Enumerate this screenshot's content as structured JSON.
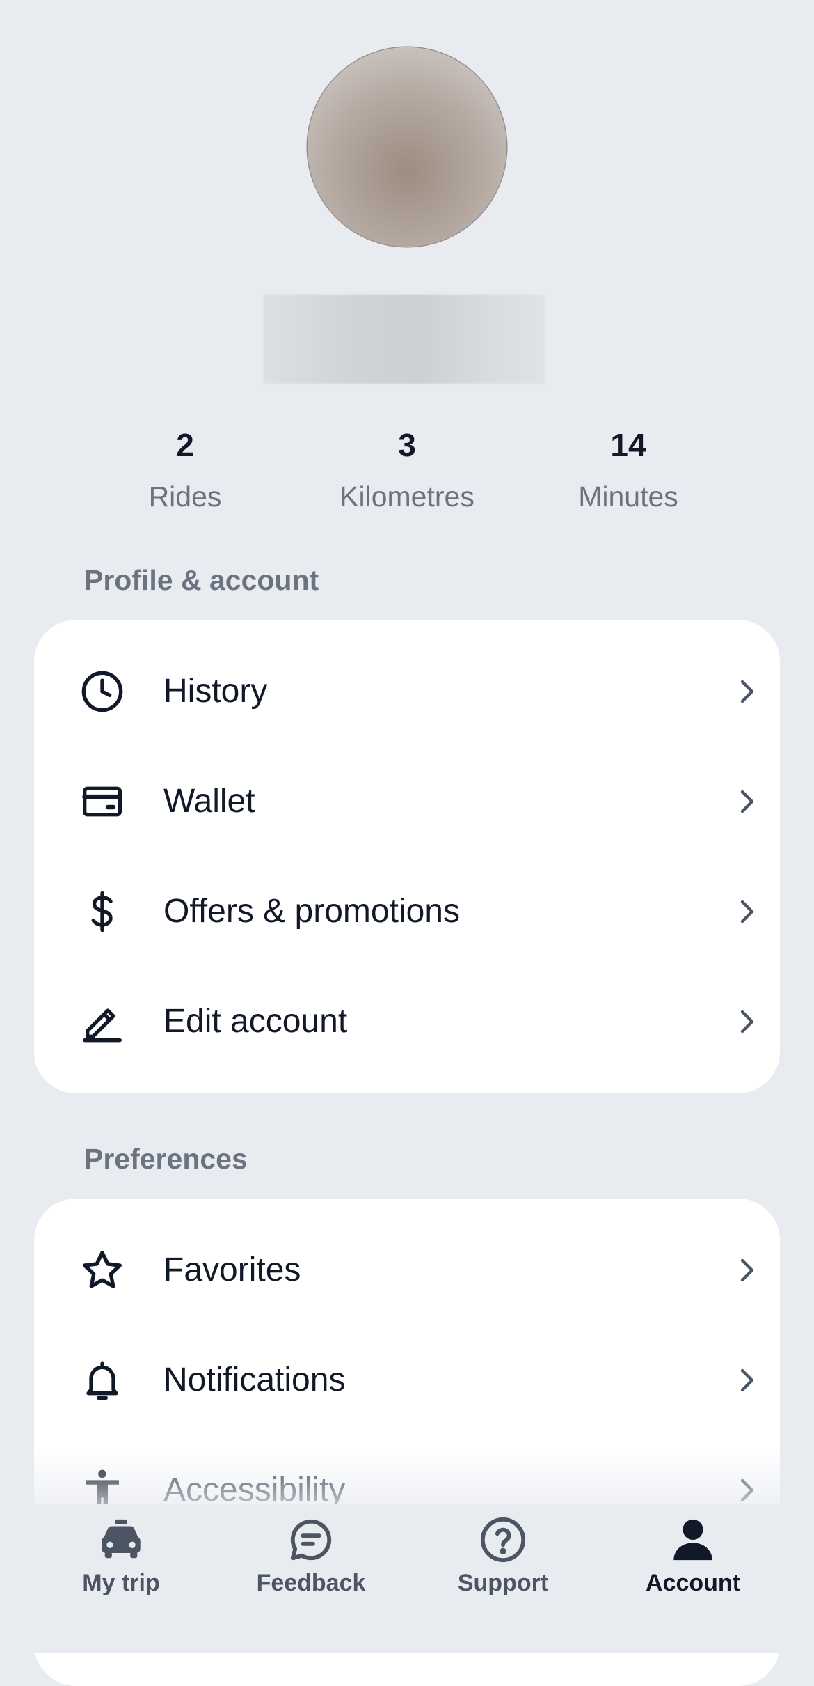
{
  "stats": [
    {
      "value": "2",
      "label": "Rides"
    },
    {
      "value": "3",
      "label": "Kilometres"
    },
    {
      "value": "14",
      "label": "Minutes"
    }
  ],
  "sections": {
    "profile": {
      "title": "Profile & account",
      "items": [
        {
          "label": "History",
          "icon": "clock-icon"
        },
        {
          "label": "Wallet",
          "icon": "credit-card-icon"
        },
        {
          "label": "Offers & promotions",
          "icon": "dollar-icon"
        },
        {
          "label": "Edit account",
          "icon": "pencil-icon"
        }
      ]
    },
    "preferences": {
      "title": "Preferences",
      "items": [
        {
          "label": "Favorites",
          "icon": "star-icon"
        },
        {
          "label": "Notifications",
          "icon": "bell-icon"
        },
        {
          "label": "Accessibility",
          "icon": "accessibility-icon"
        }
      ]
    }
  },
  "tabbar": {
    "active": "Account",
    "tabs": [
      {
        "label": "My trip",
        "icon": "car-icon"
      },
      {
        "label": "Feedback",
        "icon": "chat-bubble-icon"
      },
      {
        "label": "Support",
        "icon": "question-circle-icon"
      },
      {
        "label": "Account",
        "icon": "person-icon"
      }
    ]
  },
  "colors": {
    "background": "#e8ebf0",
    "card": "#ffffff",
    "text_primary": "#111827",
    "text_secondary": "#6b7280"
  }
}
